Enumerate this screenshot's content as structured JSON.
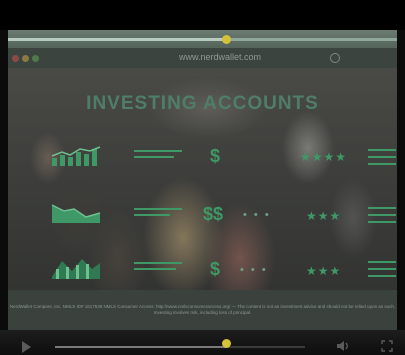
{
  "browser": {
    "url": "www.nerdwallet.com"
  },
  "video": {
    "title": "INVESTING ACCOUNTS",
    "rows": [
      {
        "icon": "bar-chart-icon",
        "symbol": "$",
        "rating": "★★★★"
      },
      {
        "icon": "area-chart-icon",
        "symbol": "$$",
        "dots": "• • •",
        "rating": "★★★"
      },
      {
        "icon": "mountain-chart-icon",
        "symbol": "$",
        "dots": "• • •",
        "rating": "★★★"
      }
    ],
    "footer": "NerdWallet Compare, Inc. NMLS ID# 1617539 NMLS Consumer Access: http://www.nmlsconsumeraccess.org/ — The content is not an investment advice and should not be relied upon as such. Investing involves risk, including loss of principal.",
    "played_fraction": 0.69
  },
  "colors": {
    "accent_green": "#3f9966",
    "title_green": "#4f7e68",
    "scrub_knob": "#d4c23a"
  },
  "controls": {
    "play_icon": "play-icon",
    "volume_icon": "volume-icon",
    "fullscreen_icon": "fullscreen-icon"
  }
}
